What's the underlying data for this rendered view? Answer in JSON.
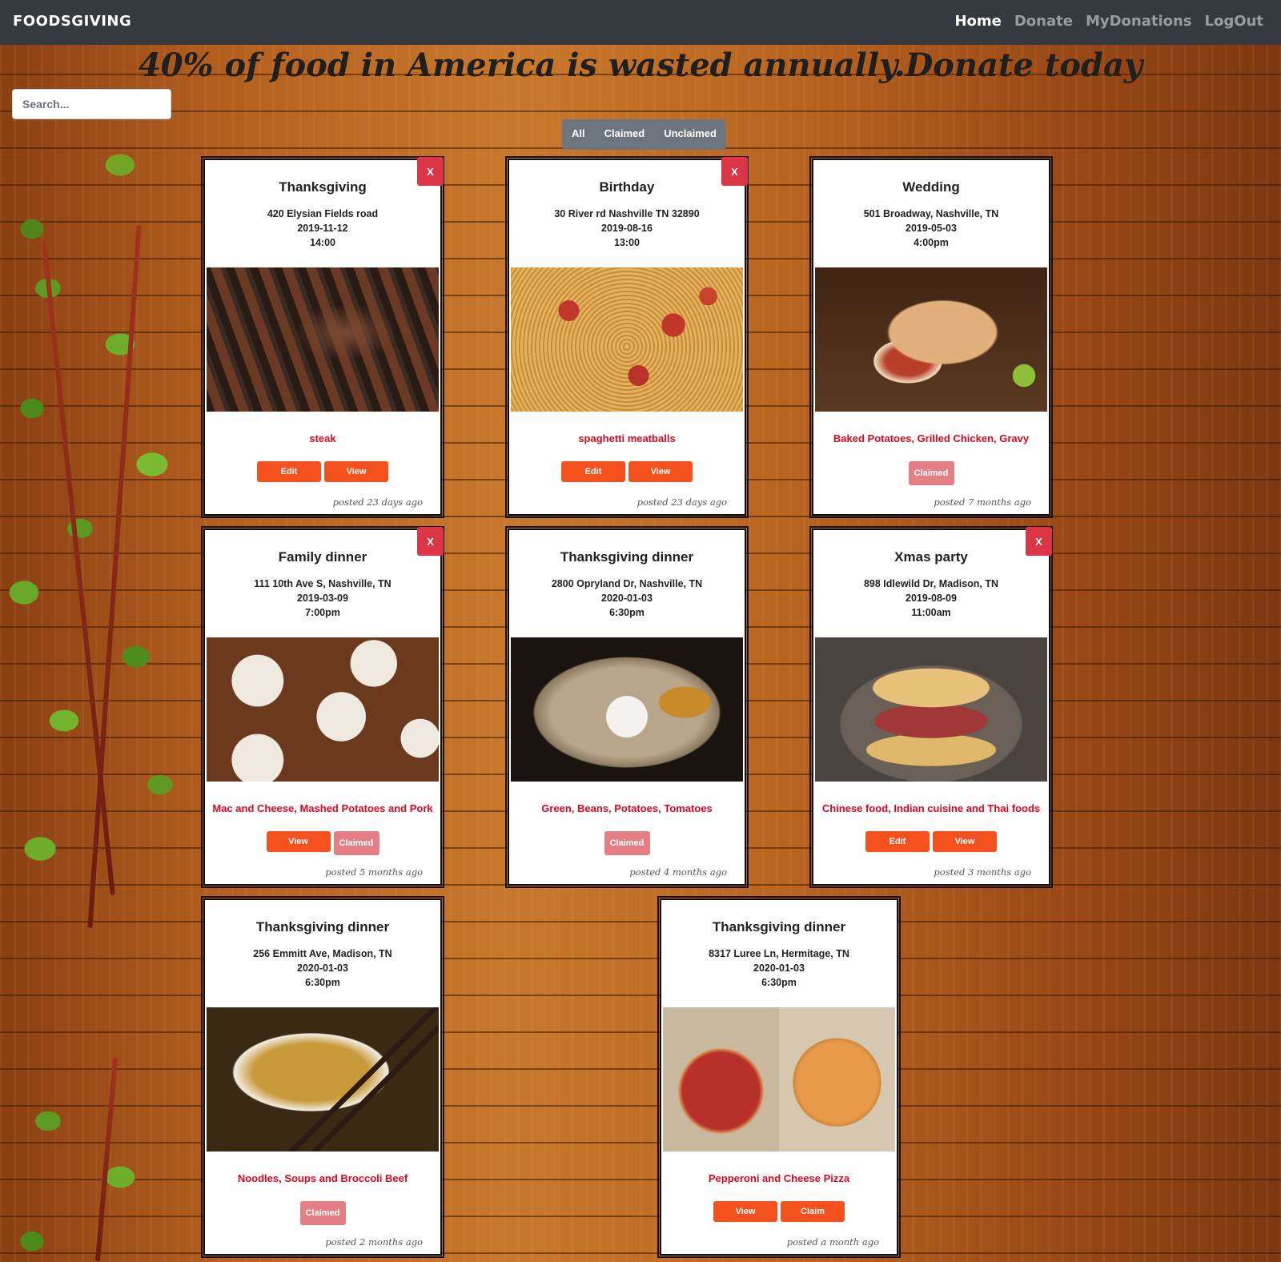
{
  "navbar": {
    "brand": "FOODSGIVING",
    "links": [
      {
        "label": "Home",
        "active": true
      },
      {
        "label": "Donate",
        "active": false
      },
      {
        "label": "MyDonations",
        "active": false
      },
      {
        "label": "LogOut",
        "active": false
      }
    ]
  },
  "headline": "40% of food in America is wasted annually.Donate today",
  "search": {
    "placeholder": "Search..."
  },
  "filters": {
    "all": "All",
    "claimed": "Claimed",
    "unclaimed": "Unclaimed"
  },
  "delete_label": "X",
  "cards": [
    {
      "title": "Thanksgiving",
      "address": "420 Elysian Fields road",
      "date": "2019-11-12",
      "time": "14:00",
      "food": "steak",
      "buttons": [
        "Edit",
        "View"
      ],
      "posted": "posted 23 days ago",
      "image": "grilled-steak",
      "colors": [
        "#3a2a22",
        "#7a4a33",
        "#2c3a1e"
      ]
    },
    {
      "title": "Birthday",
      "address": "30 River rd Nashville TN 32890",
      "date": "2019-08-16",
      "time": "13:00",
      "food": "spaghetti meatballs",
      "buttons": [
        "Edit",
        "View"
      ],
      "posted": "posted 23 days ago",
      "image": "spaghetti",
      "colors": [
        "#c98a3c",
        "#b04a22",
        "#e8cfa0"
      ]
    },
    {
      "title": "Wedding",
      "address": "501 Broadway, Nashville, TN",
      "date": "2019-05-03",
      "time": "4:00pm",
      "food": "Baked Potatoes, Grilled Chicken, Gravy",
      "buttons": [
        "Claimed"
      ],
      "posted": "posted 7 months ago",
      "image": "burrito",
      "colors": [
        "#5a3a22",
        "#d9a86a",
        "#3e2412"
      ]
    },
    {
      "title": "Family dinner",
      "address": "111 10th Ave S, Nashville, TN",
      "date": "2019-03-09",
      "time": "7:00pm",
      "food": "Mac and Cheese, Mashed Potatoes and Pork",
      "buttons": [
        "View",
        "Claimed"
      ],
      "posted": "posted 5 months ago",
      "image": "brunch-plates",
      "colors": [
        "#6b3a1e",
        "#efe9df",
        "#8a5a30"
      ]
    },
    {
      "title": "Thanksgiving dinner",
      "address": "2800 Opryland Dr, Nashville, TN",
      "date": "2020-01-03",
      "time": "6:30pm",
      "food": "Green, Beans, Potatoes, Tomatoes",
      "buttons": [
        "Claimed"
      ],
      "posted": "posted 4 months ago",
      "image": "thali-platter",
      "colors": [
        "#1a1410",
        "#b8a58a",
        "#f4f2ee"
      ]
    },
    {
      "title": "Xmas party",
      "address": "898 Idlewild Dr, Madison, TN",
      "date": "2019-08-09",
      "time": "11:00am",
      "food": "Chinese food, Indian cuisine and Thai foods",
      "buttons": [
        "Edit",
        "View"
      ],
      "posted": "posted 3 months ago",
      "image": "crepes",
      "colors": [
        "#4a4440",
        "#e8c27a",
        "#a03838"
      ]
    },
    {
      "title": "Thanksgiving dinner",
      "address": "256 Emmitt Ave, Madison, TN",
      "date": "2020-01-03",
      "time": "6:30pm",
      "food": "Noodles, Soups and Broccoli Beef",
      "buttons": [
        "Claimed"
      ],
      "posted": "posted 2 months ago",
      "image": "noodle-soup",
      "colors": [
        "#3a2a14",
        "#c89a3a",
        "#f2ede4"
      ]
    },
    {
      "title": "Thanksgiving dinner",
      "address": "8317 Luree Ln, Hermitage, TN",
      "date": "2020-01-03",
      "time": "6:30pm",
      "food": "Pepperoni and Cheese Pizza",
      "buttons": [
        "View",
        "Claim"
      ],
      "posted": "posted a month ago",
      "image": "pizza-boxes",
      "colors": [
        "#c8b8a0",
        "#b8302a",
        "#e89a4a"
      ]
    }
  ]
}
